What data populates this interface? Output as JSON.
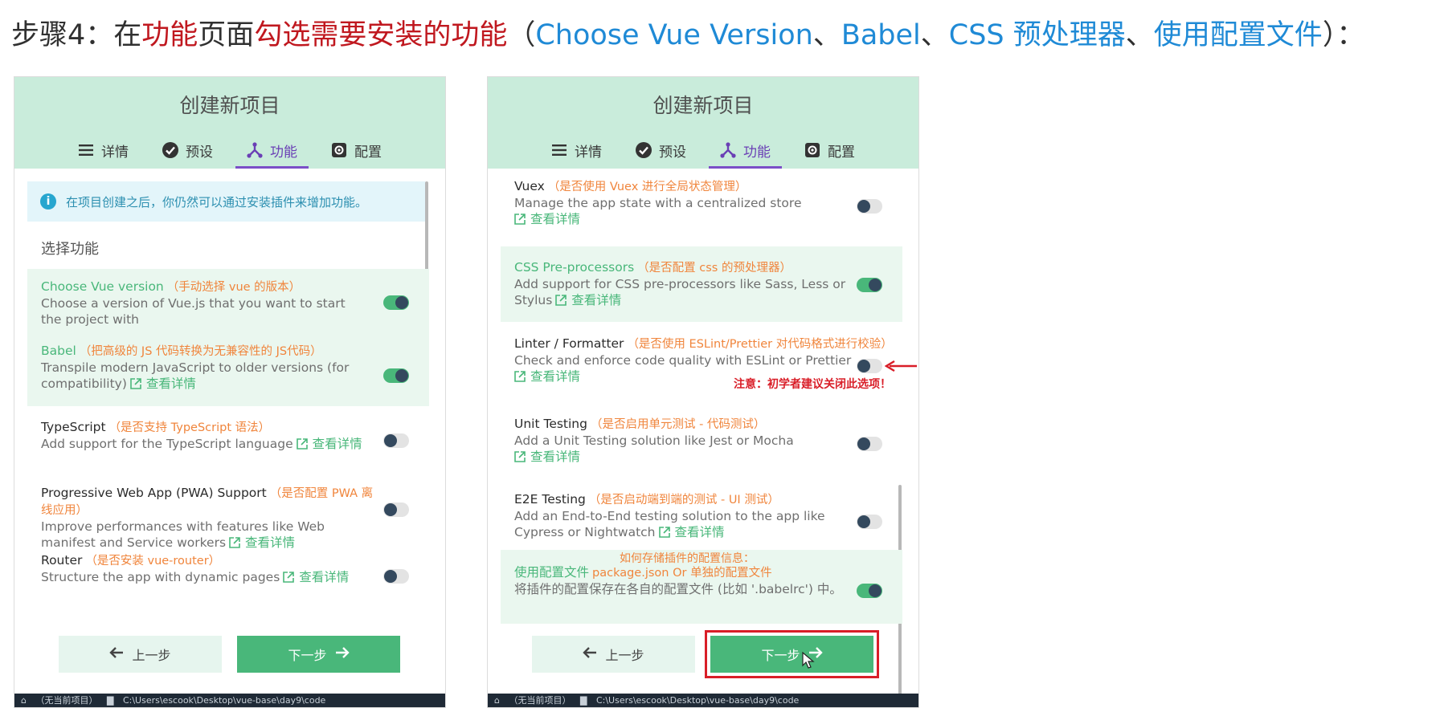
{
  "heading": {
    "prefix": "步骤4：在",
    "red1": "功能",
    "mid": "页面",
    "red2": "勾选需要安装的功能",
    "open": "（",
    "blue1": "Choose Vue Version",
    "sep1": "、",
    "blue2": "Babel",
    "sep2": "、",
    "blue3": "CSS 预处理器",
    "sep3": "、",
    "blue4": "使用配置文件",
    "close": "）："
  },
  "panel": {
    "title": "创建新项目",
    "tabs": [
      {
        "label": "详情",
        "icon": "list-icon"
      },
      {
        "label": "预设",
        "icon": "check-circle-icon"
      },
      {
        "label": "功能",
        "icon": "fork-icon"
      },
      {
        "label": "配置",
        "icon": "gear-icon"
      }
    ]
  },
  "left": {
    "info": "在项目创建之后，你仍然可以通过安装插件来增加功能。",
    "section_title": "选择功能",
    "features": [
      {
        "name": "Choose Vue version",
        "note": "（手动选择 vue 的版本）",
        "desc": "Choose a version of Vue.js that you want to start the project with",
        "more": "",
        "on": true
      },
      {
        "name": "Babel",
        "note": "（把高级的 JS 代码转换为无兼容性的 JS代码）",
        "desc": "Transpile modern JavaScript to older versions (for compatibility)",
        "more": "查看详情",
        "on": true
      },
      {
        "name": "TypeScript",
        "note": "（是否支持 TypeScript 语法）",
        "desc": "Add support for the TypeScript language",
        "more": "查看详情",
        "on": false
      },
      {
        "name": "Progressive Web App (PWA) Support",
        "note": "（是否配置 PWA 离线应用）",
        "desc": "Improve performances with features like Web manifest and Service workers",
        "more": "查看详情",
        "on": false
      },
      {
        "name": "Router",
        "note": "（是否安装 vue-router）",
        "desc": "Structure the app with dynamic pages",
        "more": "查看详情",
        "on": false
      }
    ]
  },
  "right": {
    "features": [
      {
        "name": "Vuex",
        "note": "（是否使用 Vuex 进行全局状态管理）",
        "desc": "Manage the app state with a centralized store",
        "more": "查看详情",
        "on": false
      },
      {
        "name": "CSS Pre-processors",
        "note": "（是否配置 css 的预处理器）",
        "desc": "Add support for CSS pre-processors like Sass, Less or Stylus",
        "more": "查看详情",
        "on": true
      },
      {
        "name": "Linter / Formatter",
        "note": "（是否使用 ESLint/Prettier 对代码格式进行校验）",
        "desc": "Check and enforce code quality with ESLint or Prettier",
        "more": "查看详情",
        "on": false
      },
      {
        "name": "Unit Testing",
        "note": "（是否启用单元测试 - 代码测试）",
        "desc": "Add a Unit Testing solution like Jest or Mocha",
        "more": "查看详情",
        "on": false
      },
      {
        "name": "E2E Testing",
        "note": "（是否启动端到端的测试 - UI 测试）",
        "desc": "Add an End-to-End testing solution to the app like Cypress or Nightwatch",
        "more": "查看详情",
        "on": false
      },
      {
        "name": "使用配置文件",
        "note": "package.json Or 单独的配置文件",
        "desc": "将插件的配置保存在各自的配置文件 (比如 '.babelrc') 中。",
        "more": "",
        "on": true
      }
    ],
    "lint_warning": "注意：初学者建议关闭此选项！",
    "config_hint": "如何存储插件的配置信息："
  },
  "buttons": {
    "prev": "上一步",
    "next": "下一步"
  },
  "status": {
    "project": "（无当前项目）",
    "path": "C:\\Users\\escook\\Desktop\\vue-base\\day9\\code"
  },
  "colors": {
    "accent": "#49b77a",
    "header": "#c9ecdb",
    "tab_active": "#7b4fc7",
    "annotation_red": "#d91e28",
    "annotation_orange": "#f0853c"
  }
}
